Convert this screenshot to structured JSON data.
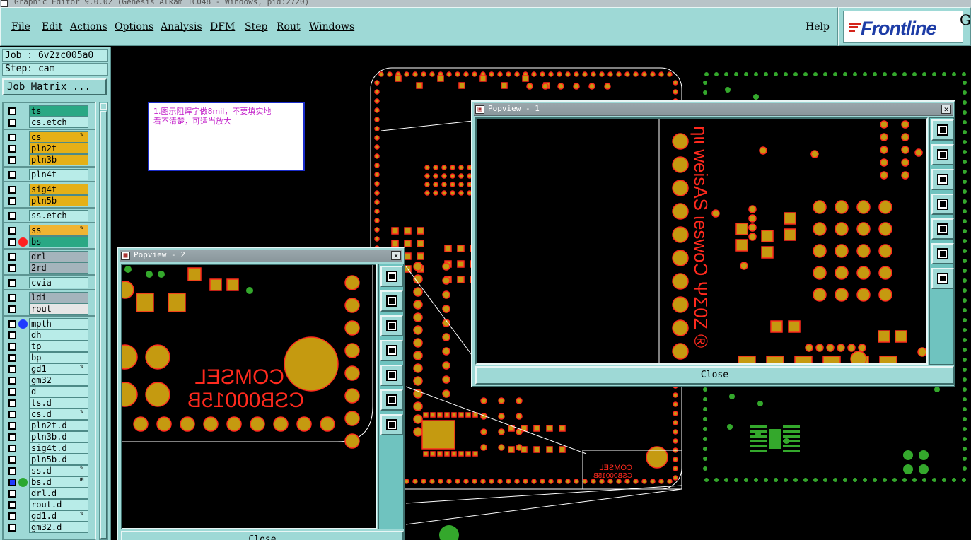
{
  "titlebar": {
    "text": "Graphic Editor 9.0.02 (Genesis Alkam 1C048 - Windows, pid:2720)"
  },
  "menu": {
    "items": [
      "File",
      "Edit",
      "Actions",
      "Options",
      "Analysis",
      "DFM",
      "Step",
      "Rout",
      "Windows"
    ],
    "help": "Help"
  },
  "logo": {
    "text": "Frontline",
    "extra": "G"
  },
  "job": {
    "job_line": "Job : 6v2zc005a0",
    "step_line": "Step: cam",
    "matrix_button": "Job Matrix ..."
  },
  "layers": [
    {
      "name": "ts",
      "color": "#2aa884",
      "dot": "",
      "mark": ""
    },
    {
      "name": "cs.etch",
      "color": "#b8ece8",
      "dot": "",
      "mark": ""
    },
    {
      "name": "cs",
      "color": "#e5b017",
      "dot": "",
      "mark": "✎"
    },
    {
      "name": "pln2t",
      "color": "#e5b017",
      "dot": "",
      "mark": ""
    },
    {
      "name": "pln3b",
      "color": "#e5b017",
      "dot": "",
      "mark": ""
    },
    {
      "name": "pln4t",
      "color": "#b8ece8",
      "dot": "",
      "mark": ""
    },
    {
      "name": "sig4t",
      "color": "#e5b017",
      "dot": "",
      "mark": ""
    },
    {
      "name": "pln5b",
      "color": "#e5b017",
      "dot": "",
      "mark": ""
    },
    {
      "name": "ss.etch",
      "color": "#b8ece8",
      "dot": "",
      "mark": ""
    },
    {
      "name": "ss",
      "color": "#f0b432",
      "dot": "",
      "mark": "✎"
    },
    {
      "name": "bs",
      "color": "#2aa884",
      "dot": "#ff2020",
      "mark": ""
    },
    {
      "name": "drl",
      "color": "#a4b4bc",
      "dot": "",
      "mark": ""
    },
    {
      "name": "2rd",
      "color": "#a4b4bc",
      "dot": "",
      "mark": ""
    },
    {
      "name": "cvia",
      "color": "#b8ece8",
      "dot": "",
      "mark": ""
    },
    {
      "name": "ldi",
      "color": "#a4b4bc",
      "dot": "",
      "mark": ""
    },
    {
      "name": "rout",
      "color": "#e6e6e6",
      "dot": "",
      "mark": ""
    },
    {
      "name": "mpth",
      "color": "#b8ece8",
      "dot": "#1f3cff",
      "mark": ""
    },
    {
      "name": "dh",
      "color": "#b8ece8",
      "dot": "",
      "mark": ""
    },
    {
      "name": "tp",
      "color": "#b8ece8",
      "dot": "",
      "mark": ""
    },
    {
      "name": "bp",
      "color": "#b8ece8",
      "dot": "",
      "mark": ""
    },
    {
      "name": "gd1",
      "color": "#b8ece8",
      "dot": "",
      "mark": "✎"
    },
    {
      "name": "gm32",
      "color": "#b8ece8",
      "dot": "",
      "mark": ""
    },
    {
      "name": "d",
      "color": "#b8ece8",
      "dot": "",
      "mark": ""
    },
    {
      "name": "ts.d",
      "color": "#b8ece8",
      "dot": "",
      "mark": ""
    },
    {
      "name": "cs.d",
      "color": "#b8ece8",
      "dot": "",
      "mark": "✎"
    },
    {
      "name": "pln2t.d",
      "color": "#b8ece8",
      "dot": "",
      "mark": ""
    },
    {
      "name": "pln3b.d",
      "color": "#b8ece8",
      "dot": "",
      "mark": ""
    },
    {
      "name": "sig4t.d",
      "color": "#b8ece8",
      "dot": "",
      "mark": ""
    },
    {
      "name": "pln5b.d",
      "color": "#b8ece8",
      "dot": "",
      "mark": ""
    },
    {
      "name": "ss.d",
      "color": "#b8ece8",
      "dot": "",
      "mark": "✎"
    },
    {
      "name": "bs.d",
      "color": "#b8ece8",
      "dot": "#2aa830",
      "mark": "⊞"
    },
    {
      "name": "drl.d",
      "color": "#b8ece8",
      "dot": "",
      "mark": ""
    },
    {
      "name": "rout.d",
      "color": "#b8ece8",
      "dot": "",
      "mark": ""
    },
    {
      "name": "gd1.d",
      "color": "#b8ece8",
      "dot": "",
      "mark": "✎"
    },
    {
      "name": "gm32.d",
      "color": "#b8ece8",
      "dot": "",
      "mark": ""
    }
  ],
  "note": {
    "text": "1.图示阻焊字做8mil，不要填实地\n看不清楚，可适当放大"
  },
  "popview1": {
    "title": "Popview - 1",
    "close_label": "Close",
    "silk_text": "ηιι weisAS ιeswoϽ ΨΣ0Ζ ®"
  },
  "popview2": {
    "title": "Popview - 2",
    "close_label": "Close",
    "silk_line1": "COMSEL",
    "silk_line2": "CSB00015B"
  },
  "board_silk": {
    "line1": "COMSEL",
    "line2": "CSB00015B"
  },
  "colors": {
    "pad": "#c59a10",
    "pad_outline": "#ff2a1e",
    "green": "#34a82c",
    "panel": "#9ed9d6"
  },
  "icons": {
    "close": "close-icon",
    "window": "window-icon",
    "tools": [
      "zoom-fit-icon",
      "pan-up-icon",
      "pan-down-icon",
      "pan-left-icon",
      "pan-right-icon",
      "zoom-in-icon",
      "zoom-out-icon"
    ]
  }
}
